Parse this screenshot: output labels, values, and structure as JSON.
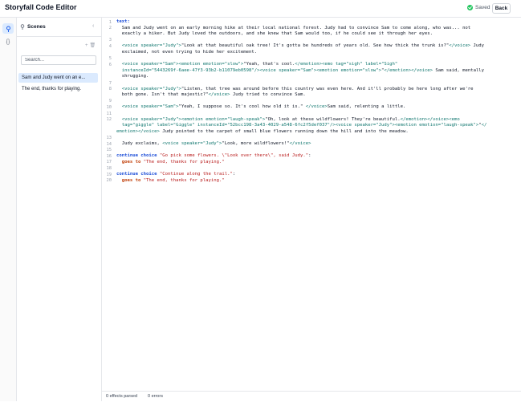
{
  "app": {
    "title": "Storyfall Code Editor",
    "saved_label": "Saved",
    "back_label": "Back"
  },
  "rail": {
    "scenes_icon": "pin-icon",
    "code_icon": "braces-icon",
    "code_glyph": "{}"
  },
  "sidebar": {
    "title": "Scenes",
    "search_placeholder": "Search...",
    "scenes": [
      {
        "label": "Sam and Judy went on an e...",
        "selected": true
      },
      {
        "label": "The end, thanks for playing.",
        "selected": false
      }
    ]
  },
  "editor": {
    "line_numbers": [
      "1",
      "2",
      "3",
      "4",
      "5",
      "6",
      "7",
      "8",
      "9",
      "10",
      "11",
      "12",
      "13",
      "14",
      "15",
      "16",
      "17",
      "18",
      "19",
      "20"
    ],
    "lines": [
      {
        "n": "1",
        "parts": [
          [
            "kw",
            "text:"
          ]
        ]
      },
      {
        "n": "2",
        "parts": [
          [
            "plain",
            "  Sam and Judy went on an early morning hike at their local national forest. Judy had to convince Sam to come along, who was... not"
          ]
        ]
      },
      {
        "n": "",
        "parts": [
          [
            "plain",
            "  exactly a hiker. But Judy loved the outdoors, and she knew that Sam would too, if he could see it through her eyes."
          ]
        ]
      },
      {
        "n": "3",
        "parts": []
      },
      {
        "n": "4",
        "parts": [
          [
            "tag",
            "  <voice speaker=\"Judy\">"
          ],
          [
            "plain",
            "\"Look at that beautiful oak tree! It's gotta be hundreds of years old. See how thick the trunk is?\""
          ],
          [
            "tag",
            "</voice>"
          ],
          [
            "plain",
            " Judy"
          ]
        ]
      },
      {
        "n": "",
        "parts": [
          [
            "plain",
            "  exclaimed, not even trying to hide her excitement."
          ]
        ]
      },
      {
        "n": "5",
        "parts": []
      },
      {
        "n": "6",
        "parts": [
          [
            "tag",
            "  <voice speaker=\"Sam\"><emotion emotion=\"slow\">"
          ],
          [
            "plain",
            "\"Yeah, that's cool."
          ],
          [
            "tag",
            "</emotion><emo tag=\"sigh\" label=\"Sigh\""
          ]
        ]
      },
      {
        "n": "",
        "parts": [
          [
            "tag",
            "  instanceId=\"5443269f-6aee-47f3-93b2-b11079eb0598\"/><voice speaker=\"Sam\"><emotion emotion=\"slow\">"
          ],
          [
            "plain",
            "\""
          ],
          [
            "tag",
            "</emotion></voice>"
          ],
          [
            "plain",
            " Sam said, mentally"
          ]
        ]
      },
      {
        "n": "",
        "parts": [
          [
            "plain",
            "  shrugging."
          ]
        ]
      },
      {
        "n": "7",
        "parts": []
      },
      {
        "n": "8",
        "parts": [
          [
            "tag",
            "  <voice speaker=\"Judy\">"
          ],
          [
            "plain",
            "\"Listen, that tree was around before this country was even here. And it'll probably be here long after we're"
          ]
        ]
      },
      {
        "n": "",
        "parts": [
          [
            "plain",
            "  both gone. Isn't that majestic?\""
          ],
          [
            "tag",
            "</voice>"
          ],
          [
            "plain",
            " Judy tried to convince Sam."
          ]
        ]
      },
      {
        "n": "9",
        "parts": []
      },
      {
        "n": "10",
        "parts": [
          [
            "tag",
            "  <voice speaker=\"Sam\">"
          ],
          [
            "plain",
            "\"Yeah, I suppose so. It's cool how old it is.\" "
          ],
          [
            "tag",
            "</voice>"
          ],
          [
            "plain",
            "Sam said, relenting a little."
          ]
        ]
      },
      {
        "n": "11",
        "parts": []
      },
      {
        "n": "12",
        "parts": [
          [
            "tag",
            "  <voice speaker=\"Judy\"><emotion emotion=\"laugh-speak\">"
          ],
          [
            "plain",
            "\"Oh, look at these wildflowers! They're beautiful."
          ],
          [
            "tag",
            "</emotion></voice><emo"
          ]
        ]
      },
      {
        "n": "",
        "parts": [
          [
            "tag",
            "  tag=\"giggle\" label=\"Giggle\" instanceId=\"52bcc198-3a43-4029-a548-6fc2f5def037\"/><voice speaker=\"Judy\"><emotion emotion=\"laugh-speak\">"
          ],
          [
            "plain",
            "\""
          ],
          [
            "tag",
            "</"
          ]
        ]
      },
      {
        "n": "",
        "parts": [
          [
            "tag",
            "emotion></voice>"
          ],
          [
            "plain",
            " Judy pointed to the carpet of small blue flowers running down the hill and into the meadow."
          ]
        ]
      },
      {
        "n": "13",
        "parts": []
      },
      {
        "n": "14",
        "parts": [
          [
            "plain",
            "  Judy exclaims, "
          ],
          [
            "tag",
            "<voice speaker=\"Judy\">"
          ],
          [
            "plain",
            "\"Look, more wildflowers!\""
          ],
          [
            "tag",
            "</voice>"
          ]
        ]
      },
      {
        "n": "15",
        "parts": []
      },
      {
        "n": "16",
        "parts": [
          [
            "kw",
            "continue choice "
          ],
          [
            "str",
            "\"Go pick some flowers. \\\"Look over there\\\", said Judy.\""
          ],
          [
            "plain",
            ":"
          ]
        ]
      },
      {
        "n": "17",
        "parts": [
          [
            "goes",
            "  goes to "
          ],
          [
            "str",
            "\"The end, thanks for playing.\""
          ]
        ]
      },
      {
        "n": "18",
        "parts": []
      },
      {
        "n": "19",
        "parts": [
          [
            "kw",
            "continue choice "
          ],
          [
            "str",
            "\"Continue along the trail.\""
          ],
          [
            "plain",
            ":"
          ]
        ]
      },
      {
        "n": "20",
        "parts": [
          [
            "goes",
            "  goes to "
          ],
          [
            "str",
            "\"The end, thanks for playing.\""
          ]
        ]
      }
    ]
  },
  "status": {
    "effects": "0 effects parsed",
    "errors": "0 errors"
  }
}
